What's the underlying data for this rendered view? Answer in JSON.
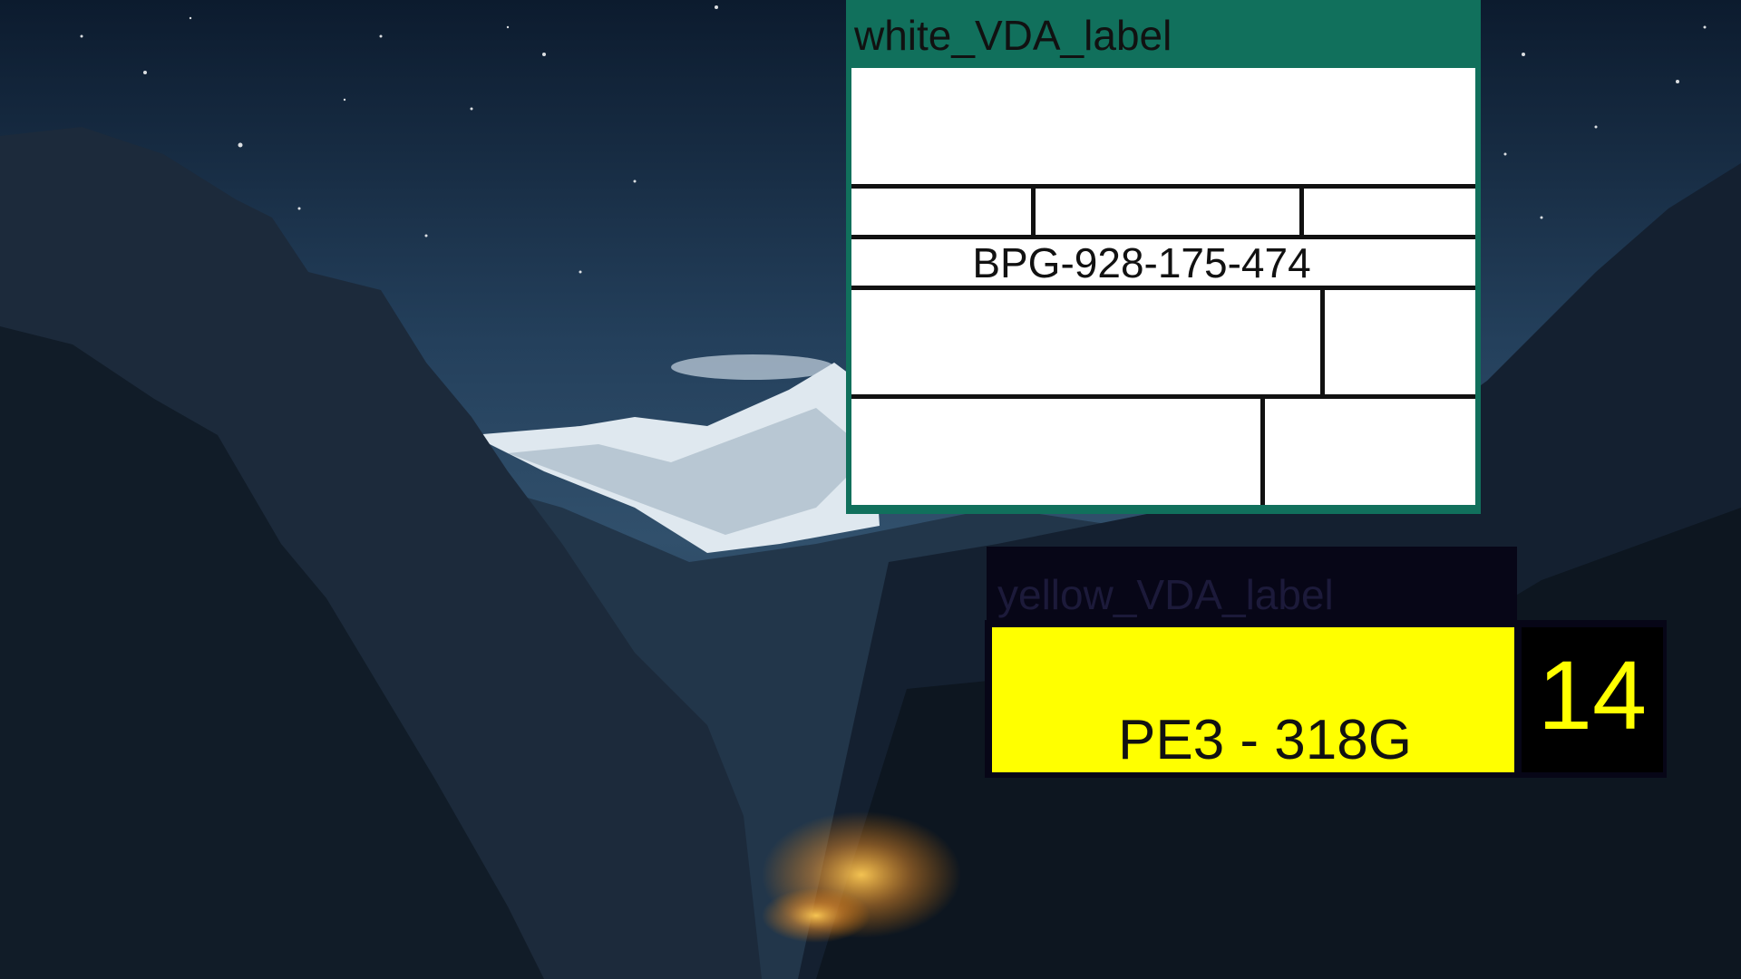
{
  "white_label": {
    "title": "white_VDA_label",
    "serial": "BPG-928-175-474"
  },
  "yellow_label": {
    "title": "yellow_VDA_label",
    "plate_text": "PE3 - 318G",
    "number": "14"
  },
  "colors": {
    "white_frame": "#11705c",
    "yellow_plate": "#ffff00",
    "yellow_window": "#070617"
  }
}
